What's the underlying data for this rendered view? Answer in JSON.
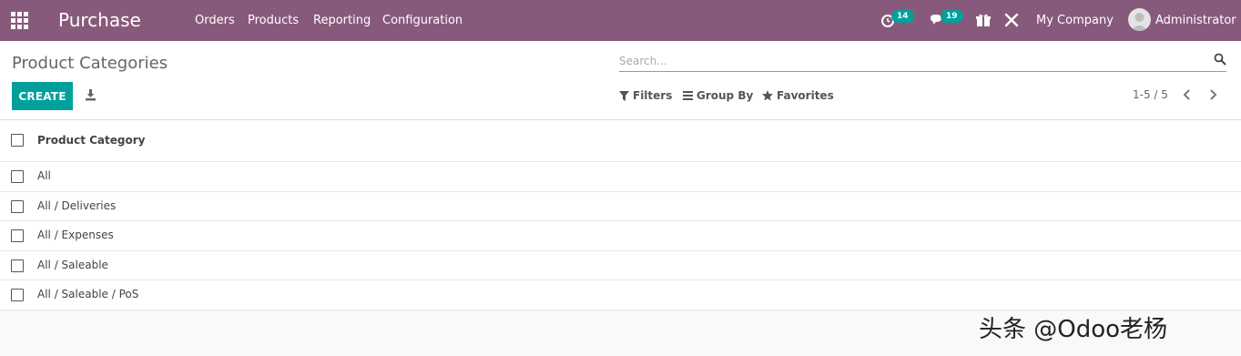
{
  "navbar": {
    "app_title": "Purchase",
    "menu": [
      "Orders",
      "Products",
      "Reporting",
      "Configuration"
    ],
    "activity_count": "14",
    "message_count": "19",
    "company": "My Company",
    "user": "Administrator",
    "color": "#875a7b"
  },
  "control_panel": {
    "title": "Product Categories",
    "search_placeholder": "Search...",
    "create_label": "CREATE",
    "filters_label": "Filters",
    "group_by_label": "Group By",
    "favorites_label": "Favorites",
    "pager": "1-5 / 5",
    "accent_color": "#00a09d"
  },
  "list": {
    "column_header": "Product Category",
    "rows": [
      "All",
      "All / Deliveries",
      "All / Expenses",
      "All / Saleable",
      "All / Saleable / PoS"
    ]
  },
  "watermark": "头条 @Odoo老杨"
}
